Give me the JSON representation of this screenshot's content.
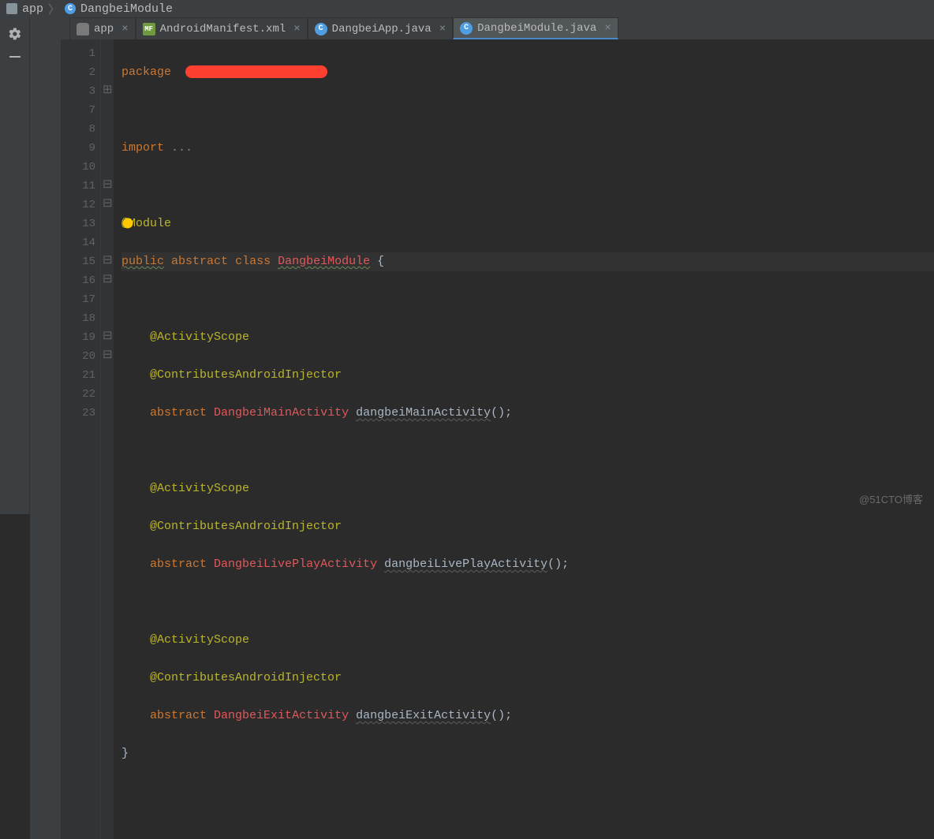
{
  "breadcrumb": {
    "folder": "app",
    "file": "DangbeiModule"
  },
  "tabs": [
    {
      "label": "app",
      "kind": "module",
      "active": false
    },
    {
      "label": "AndroidManifest.xml",
      "kind": "mf",
      "active": false
    },
    {
      "label": "DangbeiApp.java",
      "kind": "c",
      "active": false
    },
    {
      "label": "DangbeiModule.java",
      "kind": "c",
      "active": true
    }
  ],
  "gutter_lines": [
    "1",
    "2",
    "3",
    "7",
    "8",
    "9",
    "10",
    "11",
    "12",
    "13",
    "14",
    "15",
    "16",
    "17",
    "18",
    "19",
    "20",
    "21",
    "22",
    "23"
  ],
  "code": {
    "l1_kw": "package",
    "l3_kw": "import",
    "l3_dots": "...",
    "l8_ann": "@Module",
    "l9_public": "public",
    "l9_abstract": "abstract",
    "l9_class": "class",
    "l9_type": "DangbeiModule",
    "l9_brace": "{",
    "scope": "@ActivityScope",
    "contrib": "@ContributesAndroidInjector",
    "abstract": "abstract",
    "t1": "DangbeiMainActivity",
    "m1": "dangbeiMainActivity",
    "t2": "DangbeiLivePlayActivity",
    "m2": "dangbeiLivePlayActivity",
    "t3": "DangbeiExitActivity",
    "m3": "dangbeiExitActivity",
    "call": "();",
    "close": "}"
  },
  "watermark": "@51CTO博客"
}
